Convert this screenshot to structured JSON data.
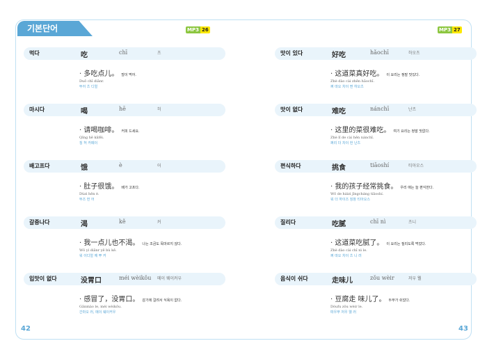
{
  "header": {
    "title": "기본단어",
    "mp3_left": {
      "label": "MP3",
      "num": "26"
    },
    "mp3_right": {
      "label": "MP3",
      "num": "27"
    }
  },
  "pages": {
    "left": "42",
    "right": "43"
  },
  "left_entries": [
    {
      "korean": "먹다",
      "hanzi": "吃",
      "pinyin": "chī",
      "pron": "츠",
      "example": {
        "hanzi": "· 多吃点儿。",
        "translation": "많이 먹어.",
        "pinyin": "Duō chī diǎnr.",
        "pron": "뚜어 츠 디얼"
      }
    },
    {
      "korean": "마시다",
      "hanzi": "喝",
      "pinyin": "hē",
      "pron": "허",
      "example": {
        "hanzi": "· 请喝咖啡。",
        "translation": "커피 드세요.",
        "pinyin": "Qǐng hē kāfēi.",
        "pron": "칭 허 카페이"
      }
    },
    {
      "korean": "배고프다",
      "hanzi": "饿",
      "pinyin": "è",
      "pron": "어",
      "example": {
        "hanzi": "· 肚子很饿。",
        "translation": "배가 고프다.",
        "pinyin": "Dùzi hěn è.",
        "pron": "뚜즈 헌 어"
      }
    },
    {
      "korean": "갈증나다",
      "hanzi": "渴",
      "pinyin": "kě",
      "pron": "커",
      "example": {
        "hanzi": "· 我一点儿也不渴。",
        "translation": "나는 조금도 목마르지 않다.",
        "pinyin": "Wǒ yì diǎnr yě bù kě.",
        "pron": "워 이디얼 예 뿌 커"
      }
    },
    {
      "korean": "입맛이 없다",
      "hanzi": "没胃口",
      "pinyin": "méi wèikǒu",
      "pron": "메이 웨이커우",
      "example": {
        "hanzi": "· 感冒了，没胃口。",
        "translation": "감기에 걸려서 식욕이 없다.",
        "pinyin": "Gǎnmào le, méi wèikǒu.",
        "pron": "간마오 러, 메이 웨이커우"
      }
    }
  ],
  "right_entries": [
    {
      "korean": "맛이 있다",
      "hanzi": "好吃",
      "pinyin": "hǎochī",
      "pron": "하오츠",
      "example": {
        "hanzi": "· 这道菜真好吃。",
        "translation": "이 요리는 정말 맛있다.",
        "pinyin": "Zhè dào cài zhēn hǎochī.",
        "pron": "쩌 따오 차이 쩐 하오츠"
      }
    },
    {
      "korean": "맛이 없다",
      "hanzi": "难吃",
      "pinyin": "nánchī",
      "pron": "난츠",
      "example": {
        "hanzi": "· 这里的菜很难吃。",
        "translation": "여기 요리는 정말 맛없다.",
        "pinyin": "Zhè lǐ de cài hěn nánchī.",
        "pron": "쩌리 더 차이 헌 난츠"
      }
    },
    {
      "korean": "편식하다",
      "hanzi": "挑食",
      "pinyin": "tiāoshí",
      "pron": "티아오스",
      "example": {
        "hanzi": "· 我的孩子经常挑食。",
        "translation": "우리 애는 늘 편식한다.",
        "pinyin": "Wǒ de háizi jīngcháng tiāoshí.",
        "pron": "워 더 하이즈 징창 티아오스"
      }
    },
    {
      "korean": "질리다",
      "hanzi": "吃腻",
      "pinyin": "chī nì",
      "pron": "츠니",
      "example": {
        "hanzi": "· 这道菜吃腻了。",
        "translation": "이 요리는 질리도록 먹었다.",
        "pinyin": "Zhè dào cài chī nì le.",
        "pron": "쩌 따오 차이 츠 니 러"
      }
    },
    {
      "korean": "음식이 쉬다",
      "hanzi": "走味儿",
      "pinyin": "zǒu wèir",
      "pron": "저우 웰",
      "example": {
        "hanzi": "· 豆腐走 味儿了。",
        "translation": "두부가 쉬었다.",
        "pinyin": "Dòufu zǒu wèir le.",
        "pron": "떠우푸 저우 웰 러"
      }
    }
  ]
}
